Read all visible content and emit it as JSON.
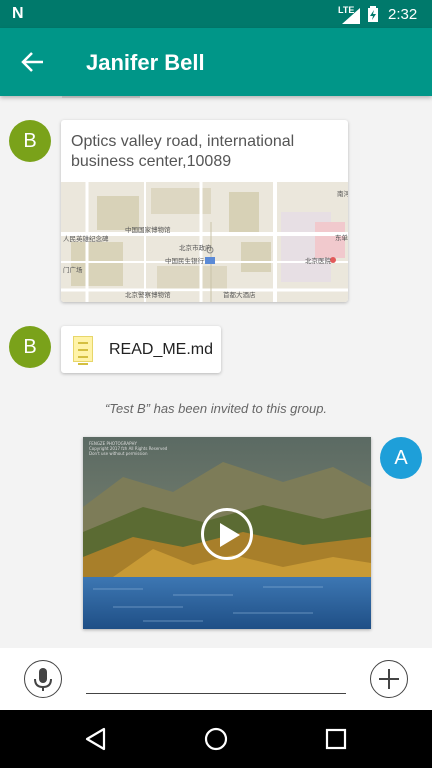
{
  "status_bar": {
    "carrier_logo": "N",
    "network": "LTE",
    "time": "2:32"
  },
  "app_bar": {
    "title": "Janifer Bell",
    "back_icon": "arrow-back-icon"
  },
  "messages": [
    {
      "type": "location",
      "sender_initial": "B",
      "address": "Optics valley road, international business center,10089",
      "map_labels": [
        "中国国家博物馆",
        "北京市政府",
        "中国民生银行",
        "北京医院",
        "北京警察博物馆",
        "首都大酒店",
        "人民英雄纪念碑",
        "门广场",
        "东单",
        "南河"
      ]
    },
    {
      "type": "file",
      "sender_initial": "B",
      "file_name": "READ_ME.md"
    },
    {
      "type": "system",
      "text": "“Test B” has been invited to this group."
    },
    {
      "type": "video",
      "sender_initial": "A",
      "credit": [
        "FENGZE PHOTOGRAPHY",
        "Copyright 2017 fzh All Rights Reserved",
        "Don't use without permission"
      ]
    }
  ],
  "input": {
    "placeholder": "",
    "value": ""
  },
  "colors": {
    "primary": "#009688",
    "primary_dark": "#00796b",
    "avatar_b": "#7aa21a",
    "avatar_a": "#1e9fd9"
  }
}
